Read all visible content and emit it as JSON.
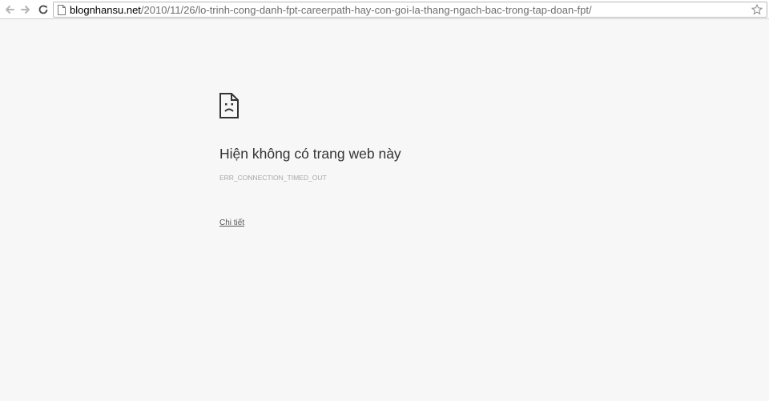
{
  "toolbar": {
    "back_icon": "arrow-left-icon",
    "forward_icon": "arrow-right-icon",
    "reload_icon": "reload-icon",
    "bookmark_icon": "star-icon"
  },
  "address_bar": {
    "host": "blognhansu.net",
    "path": "/2010/11/26/lo-trinh-cong-danh-fpt-careerpath-hay-con-goi-la-thang-ngach-bac-trong-tap-doan-fpt/",
    "page_icon": "page-icon"
  },
  "error_page": {
    "icon": "sad-page-icon",
    "title": "Hiện không có trang web này",
    "error_code": "ERR_CONNECTION_TIMED_OUT",
    "details_link": "Chi tiết"
  },
  "colors": {
    "background": "#f7f7f7",
    "title": "#333333",
    "code": "#a7a7a7"
  }
}
